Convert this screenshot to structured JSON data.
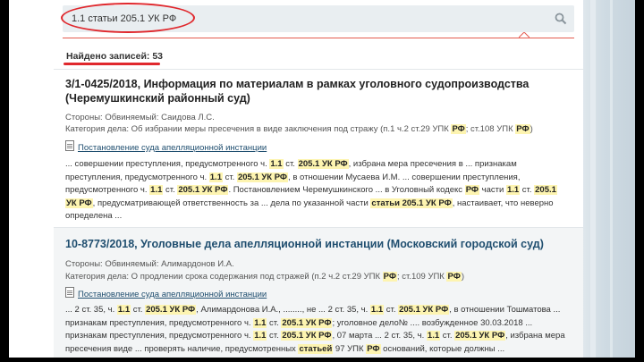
{
  "search": {
    "value": "1.1 статьи 205.1 УК РФ",
    "placeholder": ""
  },
  "found": "Найдено записей: 53",
  "results": [
    {
      "title_line1": "3/1-0425/2018, Информация по материалам в рамках уголовного судопроизводства",
      "title_line2": "(Черемушкинский районный суд)",
      "parties_label": "Стороны: ",
      "parties_value": "Обвиняемый: Саидова Л.С.",
      "category_prefix": "Категория дела: Об избрании меры пресечения в виде заключения под стражу (п.1 ч.2 ст.29 УПК ",
      "category_hl1": "РФ",
      "category_mid": "; ст.108 УПК ",
      "category_hl2": "РФ",
      "category_suffix": ")",
      "doc_link": "Постановление суда апелляционной инстанции",
      "snippet": [
        [
          "... совершении преступления, предусмотренного ч. ",
          "1.1",
          " ст. ",
          "205.1 УК РФ",
          ", избрана мера пресечения в ... признакам"
        ],
        [
          "преступления, предусмотренного ч. ",
          "1.1",
          " ст. ",
          "205.1 УК РФ",
          ", в отношении Мусаева И.М. ... совершении преступления,"
        ],
        [
          "предусмотренного ч. ",
          "1.1",
          " ст. ",
          "205.1 УК РФ",
          ". Постановлением Черемушкинского ... в Уголовный кодекс ",
          "РФ",
          " части ",
          "1.1",
          " ст. ",
          "205.1"
        ],
        [
          "",
          "УК РФ",
          ", предусматривающей ответственность за ... дела по указанной части ",
          "статьи 205.1 УК РФ",
          ", настаивает, что неверно"
        ],
        [
          "определена ...",
          "",
          "",
          "",
          ""
        ]
      ]
    },
    {
      "title_line1": "10-8773/2018, Уголовные дела апелляционной инстанции (Московский городской суд)",
      "parties_label": "Стороны: ",
      "parties_value": "Обвиняемый: Алимардонов И.А.",
      "category_prefix": "Категория дела: О продлении срока содержания под стражей (п.2 ч.2 ст.29 УПК ",
      "category_hl1": "РФ",
      "category_mid": "; ст.109 УПК ",
      "category_hl2": "РФ",
      "category_suffix": ")",
      "doc_link": "Постановление суда апелляционной инстанции",
      "snippet": [
        [
          "... 2 ст. 35, ч. ",
          "1.1",
          " ст. ",
          "205.1 УК РФ",
          ", Алимардонова И.А., ........, не ... 2 ст. 35, ч. ",
          "1.1",
          " ст. ",
          "205.1 УК РФ",
          ", в отношении Тошматова ..."
        ],
        [
          "признакам преступления, предусмотренного ч. ",
          "1.1",
          " ст. ",
          "205.1 УК РФ",
          "; уголовное дело№ .... возбужденное 30.03.2018 ...",
          "",
          "",
          "",
          ""
        ],
        [
          "признакам преступления, предусмотренного ч. ",
          "1.1",
          " ст. ",
          "205.1 УК РФ",
          ", 07 марта ... 2 ст. 35, ч. ",
          "1.1",
          " ст. ",
          "205.1 УК РФ",
          ", избрана мера"
        ],
        [
          "пресечения виде ... проверять наличие, предусмотренных ",
          "статьей",
          " 97 УПК ",
          "РФ",
          " оснований, которые должны ...",
          "",
          "",
          "",
          ""
        ]
      ]
    }
  ]
}
